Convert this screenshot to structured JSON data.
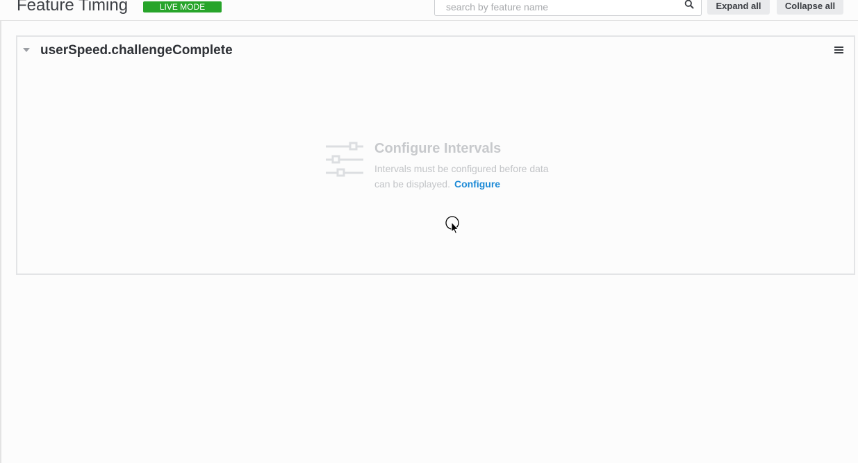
{
  "header": {
    "title": "Feature Timing",
    "badge": "LIVE MODE",
    "search": {
      "placeholder": "search by feature name",
      "value": ""
    },
    "expand_all_label": "Expand all",
    "collapse_all_label": "Collapse all"
  },
  "feature_panel": {
    "name": "userSpeed.challengeComplete",
    "expanded": true,
    "empty_state": {
      "icon": "sliders-icon",
      "title": "Configure Intervals",
      "description": "Intervals must be configured before data can be displayed.",
      "link_label": "Configure"
    }
  },
  "colors": {
    "badge_green": "#27a42a",
    "link_blue": "#1d8ad6",
    "button_bg": "#e9eaec",
    "empty_state_gray": "#c7c9cc"
  },
  "icons": [
    "search-icon",
    "caret-down-icon",
    "hamburger-menu-icon",
    "sliders-icon",
    "mouse-cursor"
  ]
}
